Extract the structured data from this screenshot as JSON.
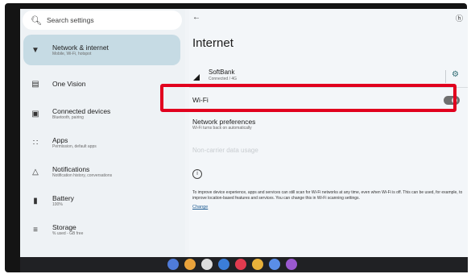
{
  "sidebar": {
    "search_placeholder": "Search settings",
    "items": [
      {
        "title": "Network & internet",
        "subtitle": "Mobile, Wi-Fi, hotspot",
        "icon": "wifi-icon",
        "active": true
      },
      {
        "title": "One Vision",
        "subtitle": "",
        "icon": "grid-icon",
        "active": false
      },
      {
        "title": "Connected devices",
        "subtitle": "Bluetooth, pairing",
        "icon": "devices-icon",
        "active": false
      },
      {
        "title": "Apps",
        "subtitle": "Permission, default apps",
        "icon": "apps-icon",
        "active": false
      },
      {
        "title": "Notifications",
        "subtitle": "Notification history, conversations",
        "icon": "bell-icon",
        "active": false
      },
      {
        "title": "Battery",
        "subtitle": "100%",
        "icon": "battery-icon",
        "active": false
      },
      {
        "title": "Storage",
        "subtitle": "% used - GB free",
        "icon": "storage-icon",
        "active": false
      }
    ]
  },
  "main": {
    "page_title": "Internet",
    "carrier": {
      "name": "SoftBank",
      "status": "Connected / 4G"
    },
    "wifi": {
      "label": "Wi-Fi",
      "enabled": false
    },
    "network_preferences": {
      "title": "Network preferences",
      "subtitle": "Wi-Fi turns back on automatically"
    },
    "non_carrier": {
      "title": "Non-carrier data usage",
      "subtitle": ""
    },
    "footer_text": "To improve device experience, apps and services can still scan for Wi-Fi networks at any time, even when Wi-Fi is off. This can be used, for example, to improve location-based features and services. You can change this in Wi-Fi scanning settings.",
    "footer_link": "Change"
  },
  "colors": {
    "accent": "#c6dbe4",
    "highlight": "#e1001e",
    "link": "#1e5c92"
  },
  "taskbar": {
    "apps": [
      {
        "name": "assistant-app-icon",
        "color": "#4f7bd9"
      },
      {
        "name": "chrome-app-icon",
        "color": "#e9a23b"
      },
      {
        "name": "camera-app-icon",
        "color": "#dcdcdc"
      },
      {
        "name": "settings-app-icon",
        "color": "#3b7dd8"
      },
      {
        "name": "play-app-icon",
        "color": "#e23b4f"
      },
      {
        "name": "photos-app-icon",
        "color": "#e8b13a"
      },
      {
        "name": "messages-app-icon",
        "color": "#5a8ee8"
      },
      {
        "name": "apps-app-icon",
        "color": "#9b59d0"
      }
    ]
  }
}
